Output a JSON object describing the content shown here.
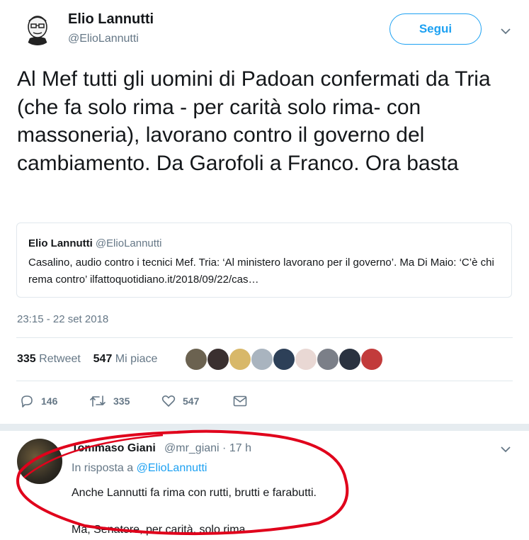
{
  "author": {
    "name": "Elio Lannutti",
    "handle": "@ElioLannutti",
    "follow_label": "Segui"
  },
  "tweet": {
    "text": "Al Mef tutti gli uomini di Padoan confermati da Tria (che fa solo rima - per carità solo rima- con massoneria), lavorano contro il governo del cambiamento. Da Garofoli a Franco. Ora basta",
    "timestamp": "23:15 - 22 set 2018"
  },
  "quoted": {
    "name": "Elio Lannutti",
    "handle": "@ElioLannutti",
    "text": "Casalino, audio contro i tecnici Mef. Tria: ‘Al ministero lavorano per il governo’. Ma Di Maio: ‘C’è chi rema contro’ ilfattoquotidiano.it/2018/09/22/cas…"
  },
  "stats": {
    "retweets_count": "335",
    "retweets_label": "Retweet",
    "likes_count": "547",
    "likes_label": "Mi piace"
  },
  "likers": [
    {
      "color": "#6b6250"
    },
    {
      "color": "#3a3030"
    },
    {
      "color": "#d8b869"
    },
    {
      "color": "#a9b4bf"
    },
    {
      "color": "#2d4058"
    },
    {
      "color": "#e9d8d4"
    },
    {
      "color": "#7b7f88"
    },
    {
      "color": "#2a3240"
    },
    {
      "color": "#c23b3b"
    }
  ],
  "actions": {
    "reply_count": "146",
    "retweet_count": "335",
    "like_count": "547"
  },
  "reply": {
    "name": "Tommaso Giani",
    "handle": "@mr_giani · 17 h",
    "in_reply_prefix": "In risposta a",
    "in_reply_handle": "@ElioLannutti",
    "line1": "Anche Lannutti fa rima con rutti, brutti e farabutti.",
    "line2": "Ma, Senatore, per carità, solo rima."
  },
  "colors": {
    "accent": "#1da1f2",
    "secondary_text": "#657786",
    "annotation": "#e0001b"
  }
}
